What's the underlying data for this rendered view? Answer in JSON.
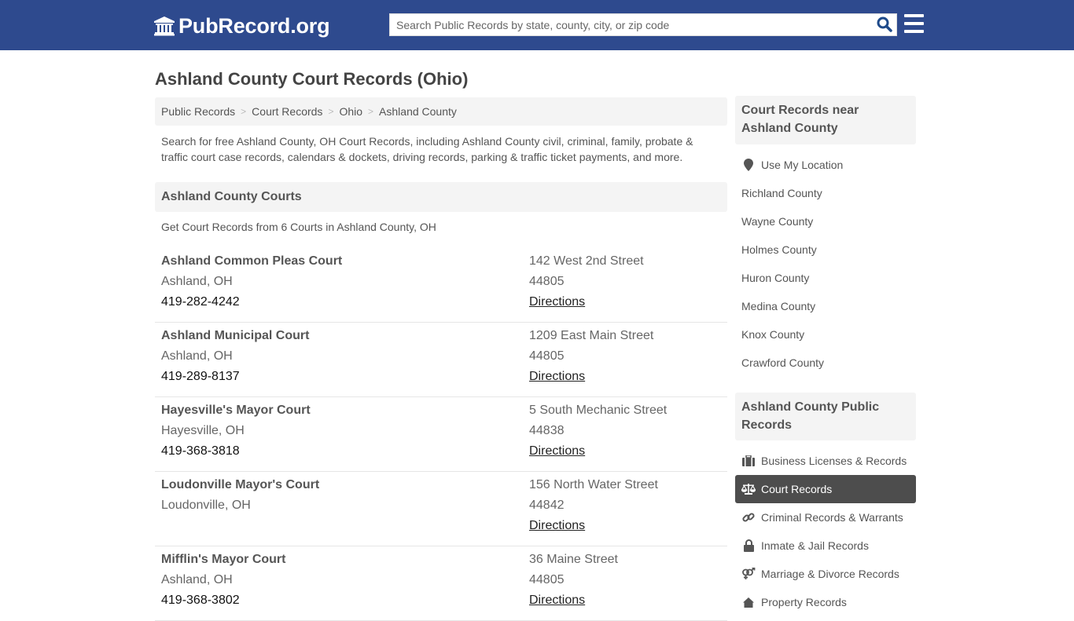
{
  "header": {
    "logo_text": "PubRecord.org",
    "search_placeholder": "Search Public Records by state, county, city, or zip code",
    "search_value": "",
    "brand_color": "#2e4a8e"
  },
  "page": {
    "title": "Ashland County Court Records (Ohio)",
    "breadcrumb": [
      "Public Records",
      "Court Records",
      "Ohio",
      "Ashland County"
    ],
    "intro": "Search for free Ashland County, OH Court Records, including Ashland County civil, criminal, family, probate & traffic court case records, calendars & dockets, driving records, parking & traffic ticket payments, and more."
  },
  "courts_section": {
    "heading": "Ashland County Courts",
    "subheading": "Get Court Records from 6 Courts in Ashland County, OH",
    "courts": [
      {
        "name": "Ashland Common Pleas Court",
        "city": "Ashland, OH",
        "phone": "419-282-4242",
        "address": "142 West 2nd Street",
        "zip": "44805",
        "directions": "Directions"
      },
      {
        "name": "Ashland Municipal Court",
        "city": "Ashland, OH",
        "phone": "419-289-8137",
        "address": "1209 East Main Street",
        "zip": "44805",
        "directions": "Directions"
      },
      {
        "name": "Hayesville's Mayor Court",
        "city": "Hayesville, OH",
        "phone": "419-368-3818",
        "address": "5 South Mechanic Street",
        "zip": "44838",
        "directions": "Directions"
      },
      {
        "name": "Loudonville Mayor's Court",
        "city": "Loudonville, OH",
        "phone": "",
        "address": "156 North Water Street",
        "zip": "44842",
        "directions": "Directions"
      },
      {
        "name": "Mifflin's Mayor Court",
        "city": "Ashland, OH",
        "phone": "419-368-3802",
        "address": "36 Maine Street",
        "zip": "44805",
        "directions": "Directions"
      }
    ]
  },
  "sidebar": {
    "nearby": {
      "heading": "Court Records near Ashland County",
      "use_location": "Use My Location",
      "counties": [
        "Richland County",
        "Wayne County",
        "Holmes County",
        "Huron County",
        "Medina County",
        "Knox County",
        "Crawford County"
      ]
    },
    "public_records": {
      "heading": "Ashland County Public Records",
      "items": [
        {
          "label": "Business Licenses & Records",
          "icon": "briefcase-icon",
          "active": false
        },
        {
          "label": "Court Records",
          "icon": "scale-icon",
          "active": true
        },
        {
          "label": "Criminal Records & Warrants",
          "icon": "link-icon",
          "active": false
        },
        {
          "label": "Inmate & Jail Records",
          "icon": "lock-icon",
          "active": false
        },
        {
          "label": "Marriage & Divorce Records",
          "icon": "venus-mars-icon",
          "active": false
        },
        {
          "label": "Property Records",
          "icon": "home-icon",
          "active": false
        }
      ]
    }
  }
}
